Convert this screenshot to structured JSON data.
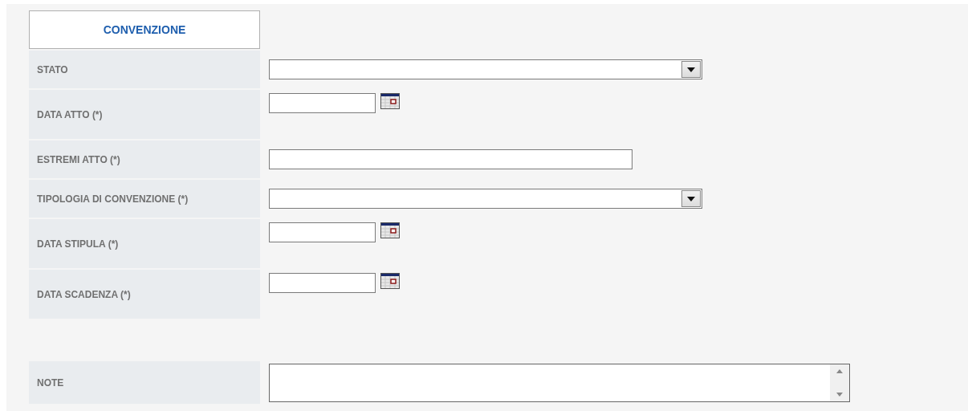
{
  "header": {
    "title": "CONVENZIONE"
  },
  "fields": [
    {
      "label": "STATO",
      "kind": "select"
    },
    {
      "label": "DATA ATTO (*)",
      "kind": "date"
    },
    {
      "label": "ESTREMI ATTO (*)",
      "kind": "text"
    },
    {
      "label": "TIPOLOGIA DI CONVENZIONE (*)",
      "kind": "select"
    },
    {
      "label": "DATA STIPULA (*)",
      "kind": "date"
    },
    {
      "label": "DATA SCADENZA (*)",
      "kind": "date"
    }
  ],
  "notes": {
    "label": "NOTE",
    "kind": "textarea"
  }
}
